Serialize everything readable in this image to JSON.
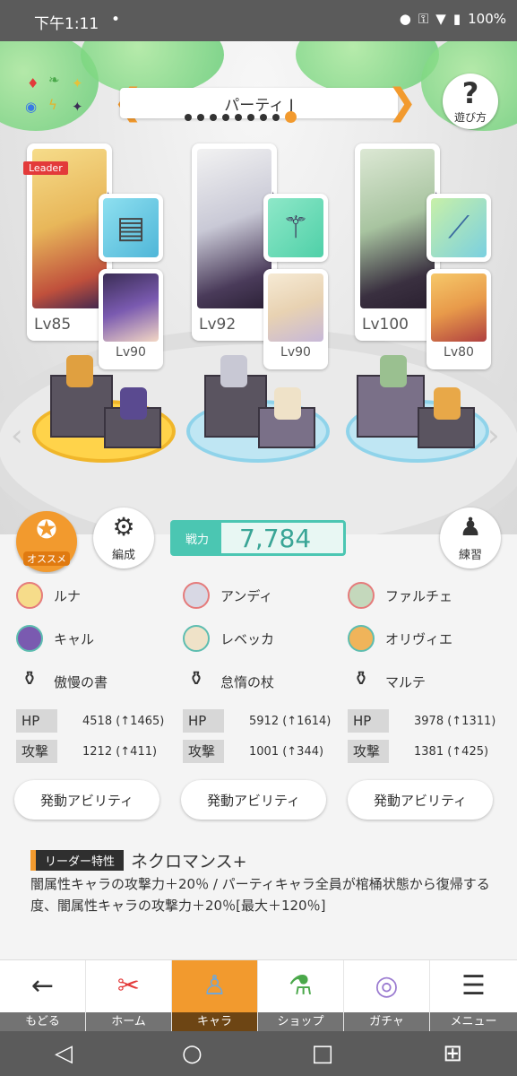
{
  "status_bar": {
    "time": "下午1:11",
    "dot": "•",
    "battery": "100%"
  },
  "header": {
    "party_title": "パーティ J",
    "help_label": "遊び方",
    "help_icon_glyph": "?",
    "left_arrow": "❮",
    "right_arrow": "❯",
    "page_count": 9,
    "active_page": 9
  },
  "teams": [
    {
      "leader_tag": "Leader",
      "main_level": "Lv85",
      "sub_level": "Lv90",
      "weapon_icon": "book-icon"
    },
    {
      "leader_tag": "",
      "main_level": "Lv92",
      "sub_level": "Lv90",
      "weapon_icon": "staff-icon"
    },
    {
      "leader_tag": "",
      "main_level": "Lv100",
      "sub_level": "Lv80",
      "weapon_icon": "spear-icon"
    }
  ],
  "actions": {
    "recommend_label": "オススメ",
    "formation_label": "編成",
    "training_label": "練習",
    "power_label": "戦力",
    "power_value": "7,784"
  },
  "columns": [
    {
      "main": "ルナ",
      "sub": "キャル",
      "weapon": "傲慢の書",
      "hp": "4518 (↑1465)",
      "atk": "1212 (↑411)",
      "ability": "発動アビリティ"
    },
    {
      "main": "アンディ",
      "sub": "レベッカ",
      "weapon": "怠惰の杖",
      "hp": "5912 (↑1614)",
      "atk": "1001 (↑344)",
      "ability": "発動アビリティ"
    },
    {
      "main": "ファルチェ",
      "sub": "オリヴィエ",
      "weapon": "マルテ",
      "hp": "3978 (↑1311)",
      "atk": "1381 (↑425)",
      "ability": "発動アビリティ"
    }
  ],
  "stat_labels": {
    "hp": "HP",
    "atk": "攻撃"
  },
  "leader_skill": {
    "tag": "リーダー特性",
    "name": "ネクロマンス+",
    "description": "闇属性キャラの攻撃力＋20％ / パーティキャラ全員が棺桶状態から復帰する度、闇属性キャラの攻撃力＋20％[最大＋120％]"
  },
  "bottom_nav": [
    {
      "label": "もどる",
      "icon": "back-arrow-icon"
    },
    {
      "label": "ホーム",
      "icon": "home-icon"
    },
    {
      "label": "キャラ",
      "icon": "character-icon"
    },
    {
      "label": "ショップ",
      "icon": "shop-icon"
    },
    {
      "label": "ガチャ",
      "icon": "gacha-icon"
    },
    {
      "label": "メニュー",
      "icon": "menu-icon"
    }
  ],
  "colors": {
    "accent": "#f29a2e",
    "power": "#4bc6b2",
    "leader_red": "#e33a3a"
  }
}
